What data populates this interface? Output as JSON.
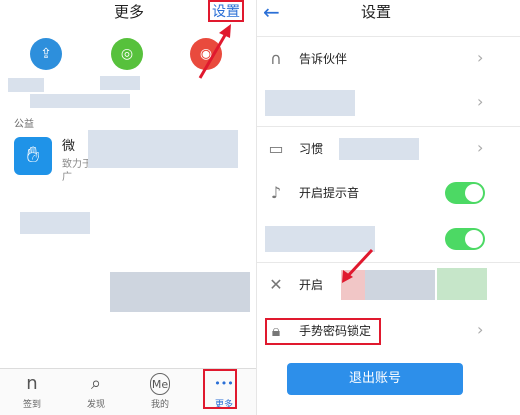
{
  "left_screen": {
    "title": "更多",
    "settings_link": "设置",
    "apps": [
      {
        "icon": "share-upload-icon",
        "color": "#2d8fdc"
      },
      {
        "icon": "wechat-icon",
        "color": "#57c13c"
      },
      {
        "icon": "weibo-icon",
        "color": "#e94a3d"
      }
    ],
    "section_label": "公益",
    "entry": {
      "icon": "hand-logo-icon",
      "title": "微",
      "desc_line1": "致力于为",
      "desc_line2": "广"
    },
    "tabs": [
      {
        "label": "签到",
        "icon": "signin-icon",
        "glyph": "n"
      },
      {
        "label": "发现",
        "icon": "search-icon",
        "glyph": "⌕"
      },
      {
        "label": "我的",
        "icon": "me-icon",
        "glyph": "Me"
      },
      {
        "label": "更多",
        "icon": "more-icon",
        "glyph": "•••"
      }
    ]
  },
  "right_screen": {
    "back_glyph": "←",
    "title": "设置",
    "rows": [
      {
        "label": "告诉伙伴",
        "icon": "bell-icon",
        "glyph": "∩",
        "control": "chevron"
      },
      {
        "label": "",
        "icon": "",
        "glyph": "",
        "control": "chevron"
      },
      {
        "label": "习惯",
        "icon": "window-icon",
        "glyph": "▭",
        "control": "chevron"
      },
      {
        "label": "开启提示音",
        "icon": "music-note-icon",
        "glyph": "♪",
        "control": "toggle",
        "on": true
      },
      {
        "label": "",
        "icon": "",
        "glyph": "",
        "control": "toggle",
        "on": true
      },
      {
        "label": "开启",
        "icon": "tools-icon",
        "glyph": "✕",
        "control": "none"
      },
      {
        "label": "手势密码锁定",
        "icon": "lock-icon",
        "glyph": "🔒︎",
        "control": "chevron"
      }
    ],
    "logout_label": "退出账号"
  },
  "colors": {
    "accent": "#2a6fd6",
    "highlight": "#e0192e",
    "toggle_on": "#4cd964",
    "logout_button": "#2d8fea"
  }
}
